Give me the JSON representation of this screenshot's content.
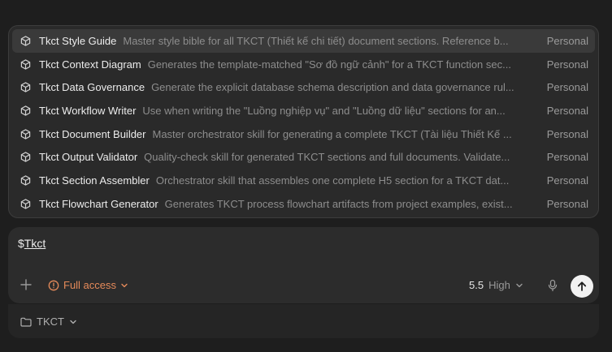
{
  "skills": [
    {
      "name": "Tkct Style Guide",
      "description": "Master style bible for all TKCT (Thiết kế chi tiết) document sections. Reference b...",
      "scope": "Personal"
    },
    {
      "name": "Tkct Context Diagram",
      "description": "Generates the template-matched \"Sơ đồ ngữ cảnh\" for a TKCT function sec...",
      "scope": "Personal"
    },
    {
      "name": "Tkct Data Governance",
      "description": "Generate the explicit database schema description and data governance rul...",
      "scope": "Personal"
    },
    {
      "name": "Tkct Workflow Writer",
      "description": "Use when writing the \"Luồng nghiệp vụ\" and \"Luồng dữ liệu\" sections for an...",
      "scope": "Personal"
    },
    {
      "name": "Tkct Document Builder",
      "description": "Master orchestrator skill for generating a complete TKCT (Tài liệu Thiết Kế ...",
      "scope": "Personal"
    },
    {
      "name": "Tkct Output Validator",
      "description": "Quality-check skill for generated TKCT sections and full documents. Validate...",
      "scope": "Personal"
    },
    {
      "name": "Tkct Section Assembler",
      "description": "Orchestrator skill that assembles one complete H5 section for a TKCT dat...",
      "scope": "Personal"
    },
    {
      "name": "Tkct Flowchart Generator",
      "description": "Generates TKCT process flowchart artifacts from project examples, exist...",
      "scope": "Personal"
    }
  ],
  "composer": {
    "prefix": "$",
    "token": "Tkct",
    "access_label": "Full access",
    "model_version": "5.5",
    "model_level": "High"
  },
  "footer": {
    "folder_label": "TKCT"
  },
  "icons": {
    "skill": "cube-icon",
    "plus": "plus-icon",
    "access": "alert-circle-icon",
    "chevron": "chevron-down-icon",
    "mic": "microphone-icon",
    "send": "arrow-up-icon",
    "folder": "folder-icon"
  },
  "colors": {
    "background": "#1e1e1e",
    "accent_warning": "#e58a5a",
    "send_button": "#f2f2f2"
  }
}
